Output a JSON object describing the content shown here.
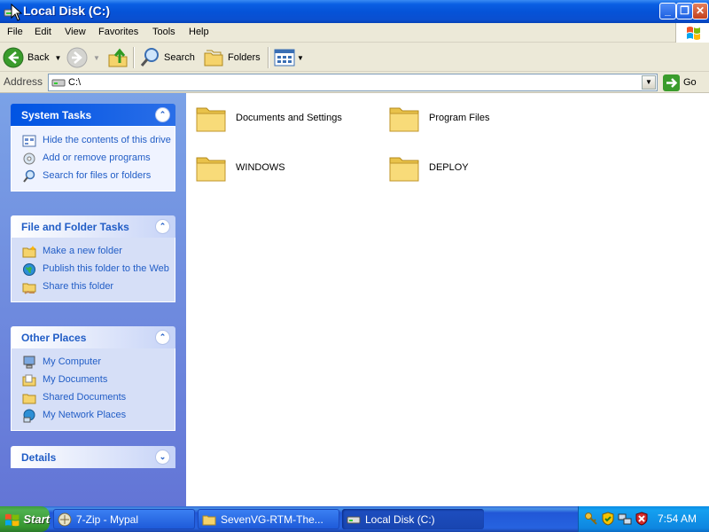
{
  "window": {
    "title": "Local Disk (C:)"
  },
  "menu": [
    "File",
    "Edit",
    "View",
    "Favorites",
    "Tools",
    "Help"
  ],
  "toolbar": {
    "back": "Back",
    "search": "Search",
    "folders": "Folders"
  },
  "address": {
    "label": "Address",
    "value": "C:\\",
    "go": "Go"
  },
  "panels": {
    "system_tasks": {
      "title": "System Tasks",
      "items": [
        "Hide the contents of this drive",
        "Add or remove programs",
        "Search for files or folders"
      ]
    },
    "file_folder_tasks": {
      "title": "File and Folder Tasks",
      "items": [
        "Make a new folder",
        "Publish this folder to the Web",
        "Share this folder"
      ]
    },
    "other_places": {
      "title": "Other Places",
      "items": [
        "My Computer",
        "My Documents",
        "Shared Documents",
        "My Network Places"
      ]
    },
    "details": {
      "title": "Details"
    }
  },
  "folders": [
    "Documents and Settings",
    "Program Files",
    "WINDOWS",
    "DEPLOY"
  ],
  "taskbar": {
    "start": "Start",
    "tasks": [
      "7-Zip - Mypal",
      "SevenVG-RTM-The...",
      "Local Disk (C:)"
    ],
    "clock": "7:54 AM"
  },
  "colors": {
    "title_blue": "#0a5fe3",
    "task_pane": "#6375d6",
    "link_blue": "#215dc6",
    "start_green": "#36962f"
  }
}
